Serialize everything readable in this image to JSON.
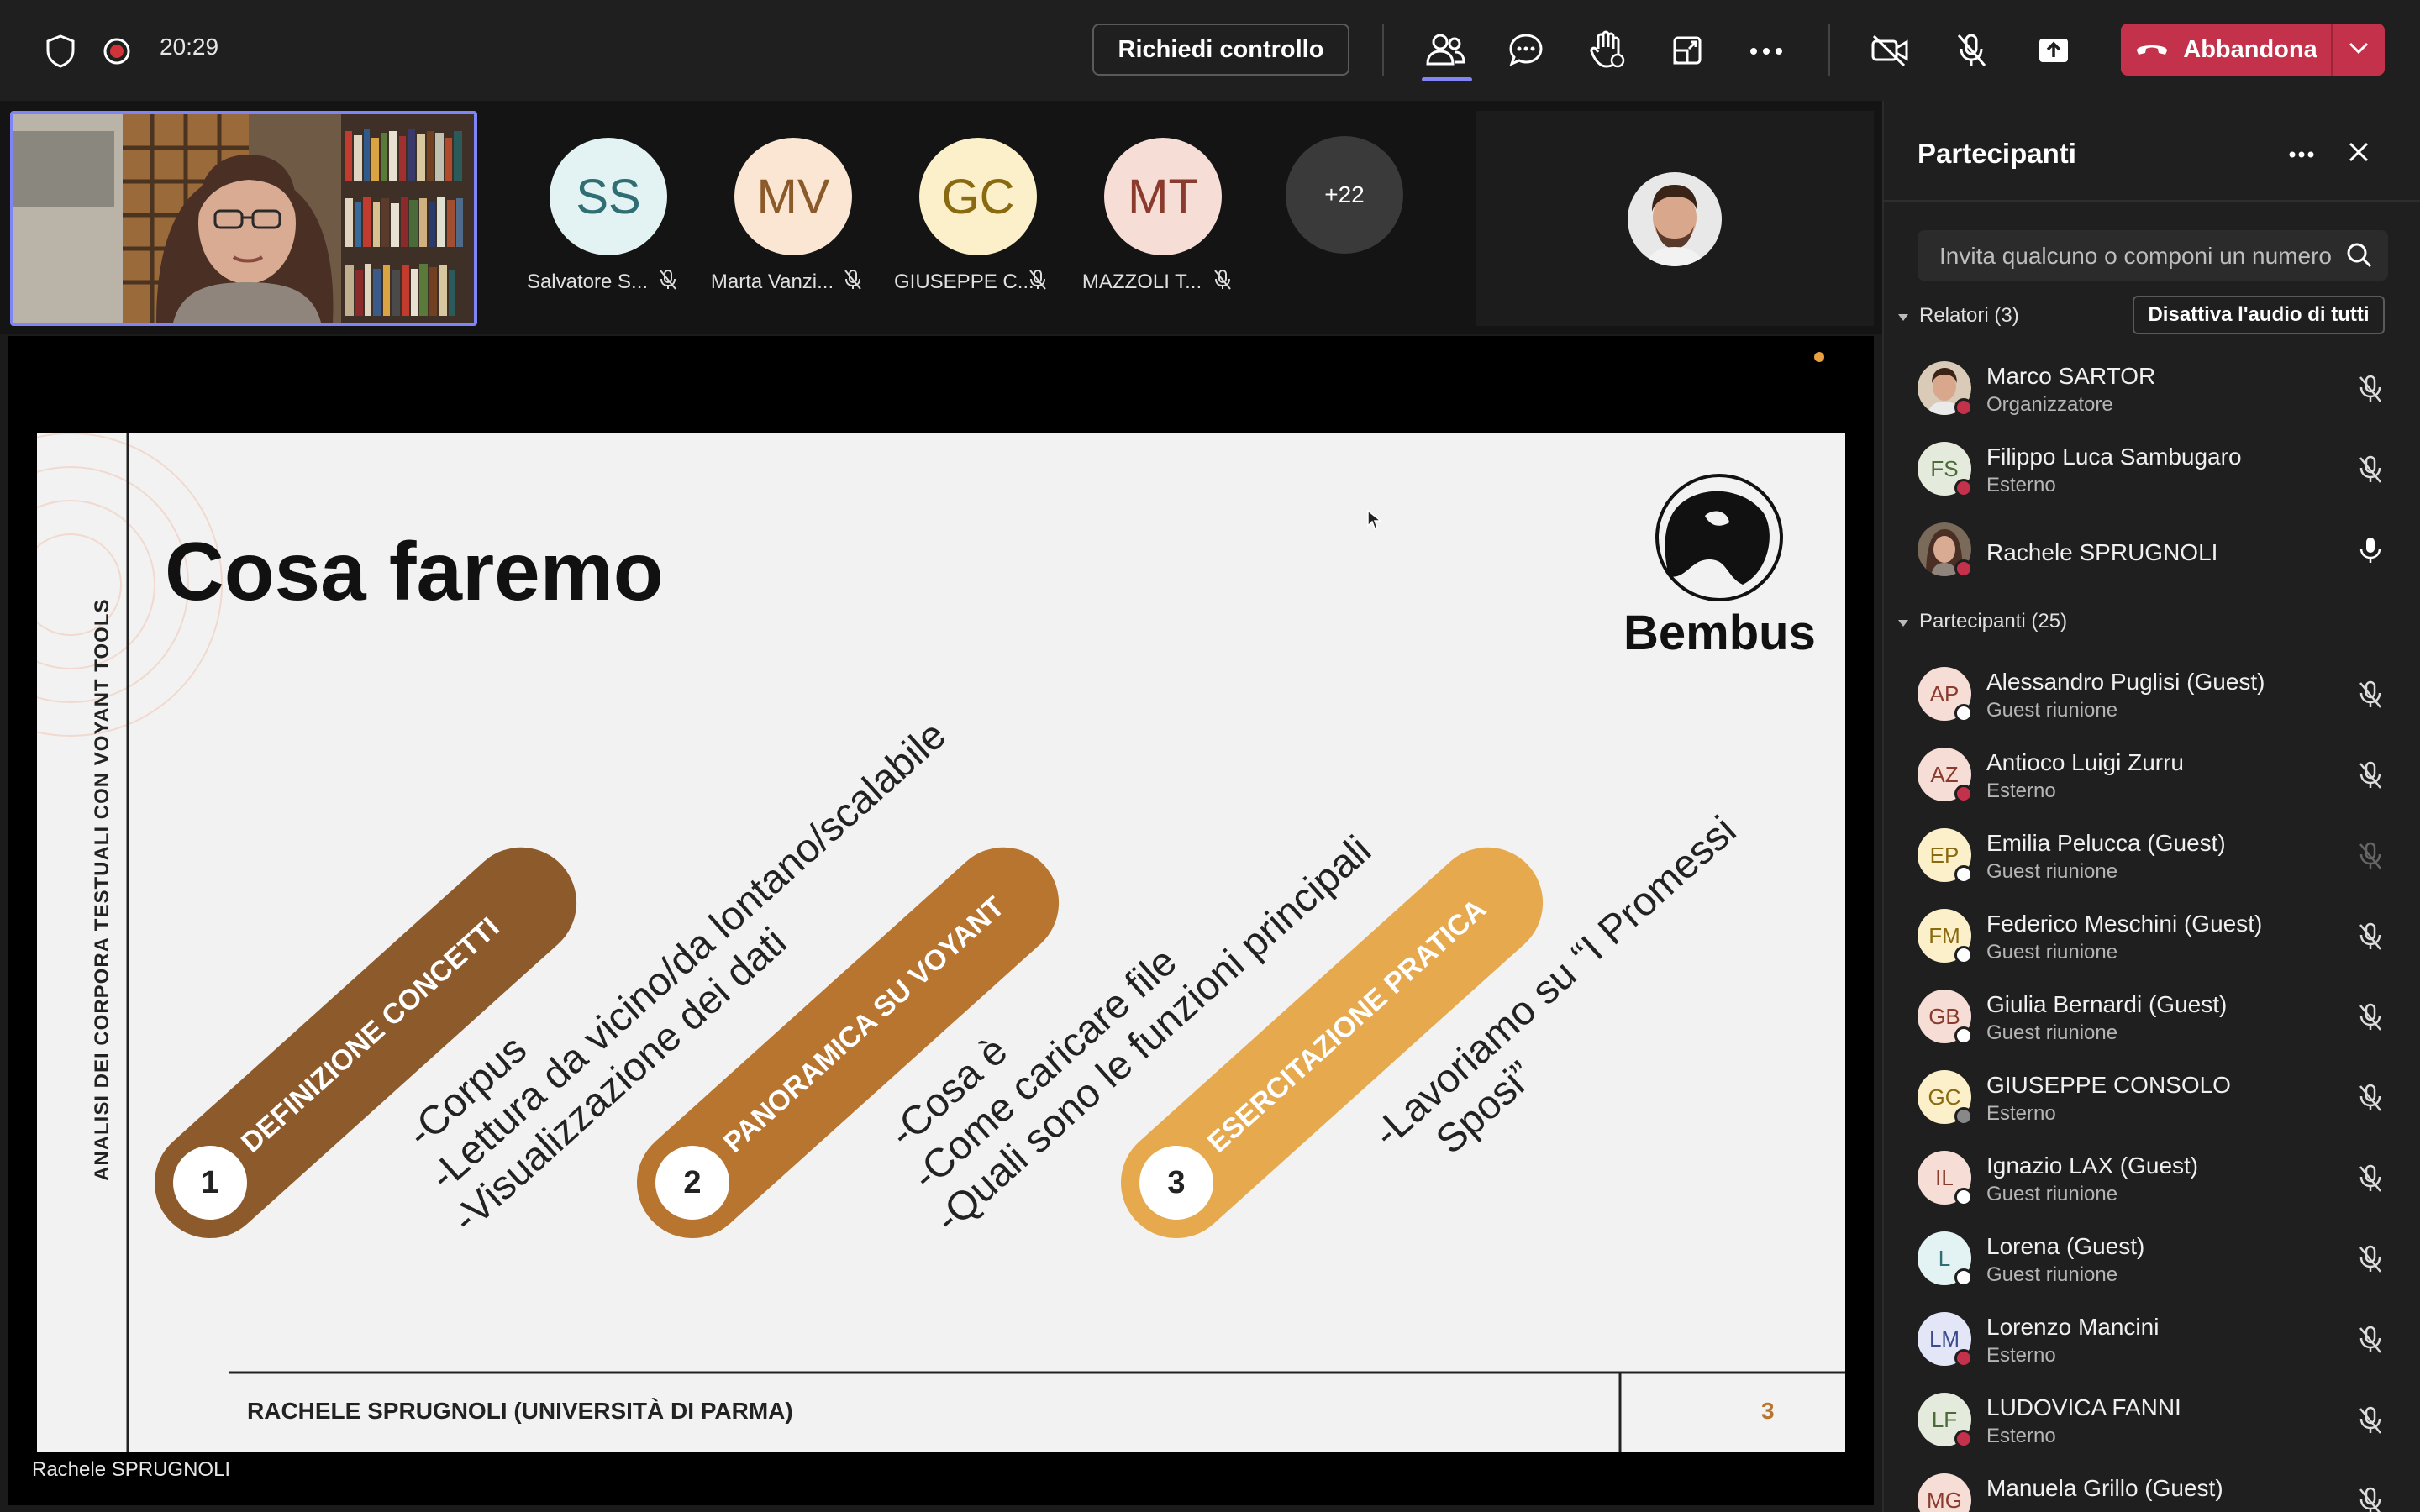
{
  "topbar": {
    "timer": "20:29",
    "request_control": "Richiedi controllo",
    "leave": "Abbandona",
    "icons": [
      "shield-icon",
      "record-icon",
      "people-icon",
      "chat-icon",
      "raise-hand-icon",
      "share-tray-icon",
      "more-icon",
      "camera-off-icon",
      "mic-off-icon",
      "share-icon",
      "phone-icon",
      "chevron-down-icon"
    ]
  },
  "strip": {
    "participants": [
      {
        "initials": "SS",
        "name": "Salvatore S...",
        "bg": "#e3f2f2",
        "fg": "#2f6f73"
      },
      {
        "initials": "MV",
        "name": "Marta Vanzi...",
        "bg": "#fbe6d3",
        "fg": "#8a5a2b"
      },
      {
        "initials": "GC",
        "name": "GIUSEPPE C...",
        "bg": "#fbf0c9",
        "fg": "#8a6a10"
      },
      {
        "initials": "MT",
        "name": "MAZZOLI T...",
        "bg": "#f6ddd6",
        "fg": "#8b3b2e"
      }
    ],
    "more": "+22"
  },
  "stage": {
    "speaker_label": "Rachele SPRUGNOLI",
    "slide": {
      "title": "Cosa faremo",
      "side_label": "ANALISI DEI CORPORA TESTUALI CON VOYANT TOOLS",
      "logo_text": "Bembus",
      "pills": [
        {
          "num": "1",
          "label": "DEFINIZIONE CONCETTI",
          "color": "#8c5a2b",
          "lines": [
            "-Corpus",
            "-Lettura da vicino/da lontano/scalabile",
            "-Visualizzazione dei dati"
          ]
        },
        {
          "num": "2",
          "label": "PANORAMICA SU VOYANT",
          "color": "#b8752f",
          "lines": [
            "-Cosa è",
            "-Come caricare file",
            "-Quali sono le funzioni principali"
          ]
        },
        {
          "num": "3",
          "label": "ESERCITAZIONE PRATICA",
          "color": "#e6a94e",
          "lines": [
            "-Lavoriamo su “I Promessi",
            "Sposi”"
          ]
        }
      ],
      "footer_author": "RACHELE SPRUGNOLI (UNIVERSITÀ DI PARMA)",
      "page_number": "3"
    }
  },
  "panel": {
    "title": "Partecipanti",
    "invite_placeholder": "Invita qualcuno o componi un numero",
    "speakers_label": "Relatori (3)",
    "mute_all": "Disattiva l'audio di tutti",
    "participants_label": "Partecipanti (25)",
    "speakers": [
      {
        "initials": "",
        "name": "Marco SARTOR",
        "role": "Organizzatore",
        "avatar": "photo",
        "bg": "#d9cbb8",
        "status": "#c4314b",
        "mic": "muted"
      },
      {
        "initials": "FS",
        "name": "Filippo Luca Sambugaro",
        "role": "Esterno",
        "avatar": "initials",
        "bg": "#e4ebdc",
        "fg": "#4b6b3a",
        "status": "#c4314b",
        "mic": "muted"
      },
      {
        "initials": "",
        "name": "Rachele SPRUGNOLI",
        "role": "",
        "avatar": "photo",
        "bg": "#6b4a3a",
        "status": "#c4314b",
        "mic": "on"
      }
    ],
    "attendees": [
      {
        "initials": "AP",
        "name": "Alessandro Puglisi (Guest)",
        "role": "Guest riunione",
        "bg": "#f6ddd6",
        "fg": "#8b3b2e",
        "status": "#ffffff",
        "mic": "muted"
      },
      {
        "initials": "AZ",
        "name": "Antioco Luigi Zurru",
        "role": "Esterno",
        "bg": "#f6ddd6",
        "fg": "#8b3b2e",
        "status": "#c4314b",
        "mic": "muted"
      },
      {
        "initials": "EP",
        "name": "Emilia Pelucca (Guest)",
        "role": "Guest riunione",
        "bg": "#fbf0c9",
        "fg": "#8a6a10",
        "status": "#ffffff",
        "mic": "unavailable"
      },
      {
        "initials": "FM",
        "name": "Federico Meschini (Guest)",
        "role": "Guest riunione",
        "bg": "#fbf0c9",
        "fg": "#8a6a10",
        "status": "#ffffff",
        "mic": "muted"
      },
      {
        "initials": "GB",
        "name": "Giulia Bernardi (Guest)",
        "role": "Guest riunione",
        "bg": "#f6ddd6",
        "fg": "#8b3b2e",
        "status": "#ffffff",
        "mic": "muted"
      },
      {
        "initials": "GC",
        "name": "GIUSEPPE CONSOLO",
        "role": "Esterno",
        "bg": "#fbf0c9",
        "fg": "#8a6a10",
        "status": "#888888",
        "mic": "muted"
      },
      {
        "initials": "IL",
        "name": "Ignazio LAX (Guest)",
        "role": "Guest riunione",
        "bg": "#f6ddd6",
        "fg": "#8b3b2e",
        "status": "#ffffff",
        "mic": "muted"
      },
      {
        "initials": "L",
        "name": "Lorena (Guest)",
        "role": "Guest riunione",
        "bg": "#e3f2f2",
        "fg": "#2f6f73",
        "status": "#ffffff",
        "mic": "muted"
      },
      {
        "initials": "LM",
        "name": "Lorenzo Mancini",
        "role": "Esterno",
        "bg": "#e3e6f7",
        "fg": "#3b4a8b",
        "status": "#c4314b",
        "mic": "muted"
      },
      {
        "initials": "LF",
        "name": "LUDOVICA FANNI",
        "role": "Esterno",
        "bg": "#e4ebdc",
        "fg": "#4b6b3a",
        "status": "#c4314b",
        "mic": "muted"
      },
      {
        "initials": "MG",
        "name": "Manuela Grillo (Guest)",
        "role": "",
        "bg": "#f6ddd6",
        "fg": "#8b3b2e",
        "status": "#ffffff",
        "mic": "muted"
      }
    ]
  }
}
